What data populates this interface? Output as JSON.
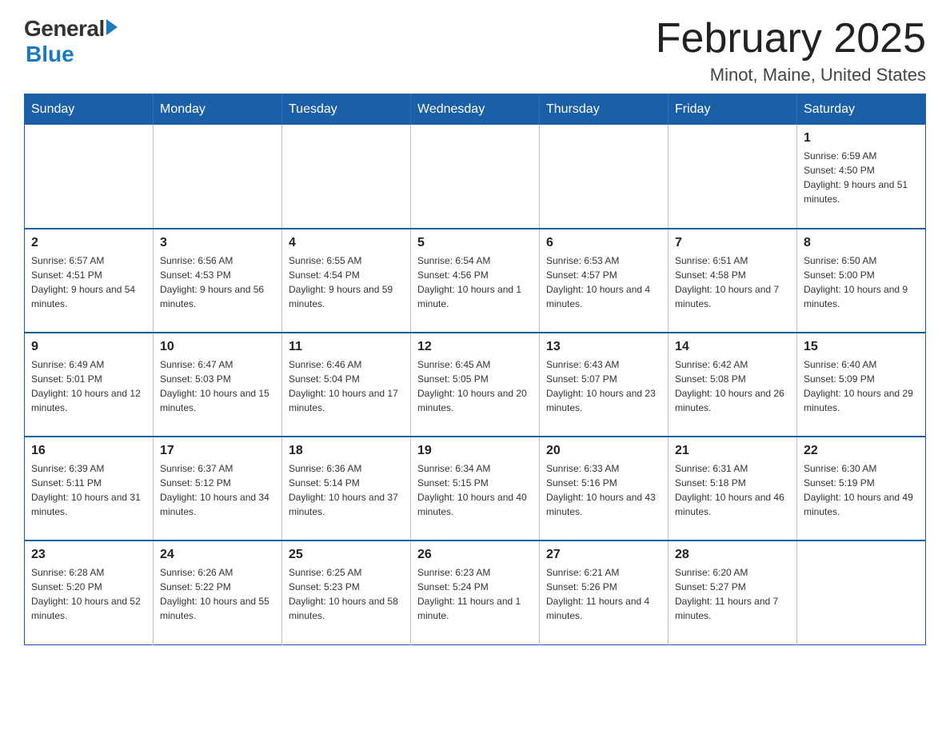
{
  "logo": {
    "general": "General",
    "blue": "Blue"
  },
  "title": "February 2025",
  "subtitle": "Minot, Maine, United States",
  "weekdays": [
    "Sunday",
    "Monday",
    "Tuesday",
    "Wednesday",
    "Thursday",
    "Friday",
    "Saturday"
  ],
  "weeks": [
    [
      {
        "day": "",
        "info": ""
      },
      {
        "day": "",
        "info": ""
      },
      {
        "day": "",
        "info": ""
      },
      {
        "day": "",
        "info": ""
      },
      {
        "day": "",
        "info": ""
      },
      {
        "day": "",
        "info": ""
      },
      {
        "day": "1",
        "info": "Sunrise: 6:59 AM\nSunset: 4:50 PM\nDaylight: 9 hours and 51 minutes."
      }
    ],
    [
      {
        "day": "2",
        "info": "Sunrise: 6:57 AM\nSunset: 4:51 PM\nDaylight: 9 hours and 54 minutes."
      },
      {
        "day": "3",
        "info": "Sunrise: 6:56 AM\nSunset: 4:53 PM\nDaylight: 9 hours and 56 minutes."
      },
      {
        "day": "4",
        "info": "Sunrise: 6:55 AM\nSunset: 4:54 PM\nDaylight: 9 hours and 59 minutes."
      },
      {
        "day": "5",
        "info": "Sunrise: 6:54 AM\nSunset: 4:56 PM\nDaylight: 10 hours and 1 minute."
      },
      {
        "day": "6",
        "info": "Sunrise: 6:53 AM\nSunset: 4:57 PM\nDaylight: 10 hours and 4 minutes."
      },
      {
        "day": "7",
        "info": "Sunrise: 6:51 AM\nSunset: 4:58 PM\nDaylight: 10 hours and 7 minutes."
      },
      {
        "day": "8",
        "info": "Sunrise: 6:50 AM\nSunset: 5:00 PM\nDaylight: 10 hours and 9 minutes."
      }
    ],
    [
      {
        "day": "9",
        "info": "Sunrise: 6:49 AM\nSunset: 5:01 PM\nDaylight: 10 hours and 12 minutes."
      },
      {
        "day": "10",
        "info": "Sunrise: 6:47 AM\nSunset: 5:03 PM\nDaylight: 10 hours and 15 minutes."
      },
      {
        "day": "11",
        "info": "Sunrise: 6:46 AM\nSunset: 5:04 PM\nDaylight: 10 hours and 17 minutes."
      },
      {
        "day": "12",
        "info": "Sunrise: 6:45 AM\nSunset: 5:05 PM\nDaylight: 10 hours and 20 minutes."
      },
      {
        "day": "13",
        "info": "Sunrise: 6:43 AM\nSunset: 5:07 PM\nDaylight: 10 hours and 23 minutes."
      },
      {
        "day": "14",
        "info": "Sunrise: 6:42 AM\nSunset: 5:08 PM\nDaylight: 10 hours and 26 minutes."
      },
      {
        "day": "15",
        "info": "Sunrise: 6:40 AM\nSunset: 5:09 PM\nDaylight: 10 hours and 29 minutes."
      }
    ],
    [
      {
        "day": "16",
        "info": "Sunrise: 6:39 AM\nSunset: 5:11 PM\nDaylight: 10 hours and 31 minutes."
      },
      {
        "day": "17",
        "info": "Sunrise: 6:37 AM\nSunset: 5:12 PM\nDaylight: 10 hours and 34 minutes."
      },
      {
        "day": "18",
        "info": "Sunrise: 6:36 AM\nSunset: 5:14 PM\nDaylight: 10 hours and 37 minutes."
      },
      {
        "day": "19",
        "info": "Sunrise: 6:34 AM\nSunset: 5:15 PM\nDaylight: 10 hours and 40 minutes."
      },
      {
        "day": "20",
        "info": "Sunrise: 6:33 AM\nSunset: 5:16 PM\nDaylight: 10 hours and 43 minutes."
      },
      {
        "day": "21",
        "info": "Sunrise: 6:31 AM\nSunset: 5:18 PM\nDaylight: 10 hours and 46 minutes."
      },
      {
        "day": "22",
        "info": "Sunrise: 6:30 AM\nSunset: 5:19 PM\nDaylight: 10 hours and 49 minutes."
      }
    ],
    [
      {
        "day": "23",
        "info": "Sunrise: 6:28 AM\nSunset: 5:20 PM\nDaylight: 10 hours and 52 minutes."
      },
      {
        "day": "24",
        "info": "Sunrise: 6:26 AM\nSunset: 5:22 PM\nDaylight: 10 hours and 55 minutes."
      },
      {
        "day": "25",
        "info": "Sunrise: 6:25 AM\nSunset: 5:23 PM\nDaylight: 10 hours and 58 minutes."
      },
      {
        "day": "26",
        "info": "Sunrise: 6:23 AM\nSunset: 5:24 PM\nDaylight: 11 hours and 1 minute."
      },
      {
        "day": "27",
        "info": "Sunrise: 6:21 AM\nSunset: 5:26 PM\nDaylight: 11 hours and 4 minutes."
      },
      {
        "day": "28",
        "info": "Sunrise: 6:20 AM\nSunset: 5:27 PM\nDaylight: 11 hours and 7 minutes."
      },
      {
        "day": "",
        "info": ""
      }
    ]
  ]
}
